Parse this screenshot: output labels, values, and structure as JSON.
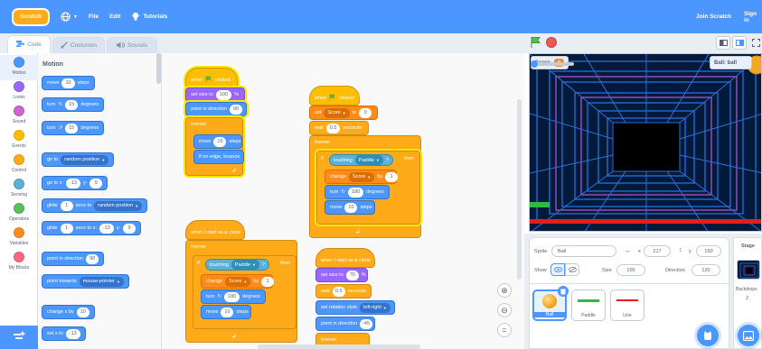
{
  "menu": {
    "logo": "Scratch",
    "file": "File",
    "edit": "Edit",
    "tutorials": "Tutorials",
    "join": "Join Scratch",
    "signin": "Sign in"
  },
  "tabs": {
    "code": "Code",
    "costumes": "Costumes",
    "sounds": "Sounds"
  },
  "categories": [
    {
      "label": "Motion",
      "color": "#4c97ff"
    },
    {
      "label": "Looks",
      "color": "#9966ff"
    },
    {
      "label": "Sound",
      "color": "#cf63cf"
    },
    {
      "label": "Events",
      "color": "#ffbf00"
    },
    {
      "label": "Control",
      "color": "#ffab19"
    },
    {
      "label": "Sensing",
      "color": "#5cb1d6"
    },
    {
      "label": "Operators",
      "color": "#59c059"
    },
    {
      "label": "Variables",
      "color": "#ff8c1a"
    },
    {
      "label": "My Blocks",
      "color": "#ff6680"
    }
  ],
  "palette": {
    "title": "Motion",
    "move": {
      "pre": "move",
      "val": "10",
      "post": "steps"
    },
    "turn_right": {
      "pre": "turn",
      "val": "15",
      "post": "degrees"
    },
    "turn_left": {
      "pre": "turn",
      "val": "15",
      "post": "degrees"
    },
    "goto": {
      "pre": "go to",
      "opt": "random position"
    },
    "goto_xy": {
      "pre": "go to x:",
      "x": "-13",
      "ylab": "y:",
      "y": "9"
    },
    "glide_to": {
      "pre": "glide",
      "val": "1",
      "mid": "secs to",
      "opt": "random position"
    },
    "glide_xy": {
      "pre": "glide",
      "val": "1",
      "mid": "secs to x:",
      "x": "-13",
      "ylab": "y:",
      "y": "9"
    },
    "point_dir": {
      "pre": "point in direction",
      "val": "90"
    },
    "point_towards": {
      "pre": "point towards",
      "opt": "mouse-pointer"
    },
    "change_x": {
      "pre": "change x by",
      "val": "10"
    },
    "set_x": {
      "pre": "set x to",
      "val": "-13"
    }
  },
  "script1": {
    "hat": "when",
    "hat_post": "clicked",
    "setsize": {
      "pre": "set size to",
      "val": "100",
      "post": "%"
    },
    "point": {
      "pre": "point in direction",
      "val": "90"
    },
    "forever": "forever",
    "move": {
      "pre": "move",
      "val": "15",
      "post": "steps"
    },
    "bounce": "if on edge, bounce"
  },
  "script2": {
    "hat": "when",
    "hat_post": "clicked",
    "set": {
      "pre": "set",
      "var": "Score",
      "mid": "to",
      "val": "0"
    },
    "wait": {
      "pre": "wait",
      "val": "0.5",
      "post": "seconds"
    },
    "forever": "forever",
    "if_pre": "if",
    "touching": "touching",
    "touch_opt": "Paddle",
    "q": "?",
    "then": "then",
    "change": {
      "pre": "change",
      "var": "Score",
      "mid": "by",
      "val": "1"
    },
    "turn": {
      "pre": "turn",
      "val": "180",
      "post": "degrees"
    },
    "move": {
      "pre": "move",
      "val": "10",
      "post": "steps"
    }
  },
  "script3": {
    "hat": "when I start as a clone",
    "forever": "forever",
    "if_pre": "if",
    "touching": "touching",
    "touch_opt": "Paddle",
    "q": "?",
    "then": "then",
    "change": {
      "pre": "change",
      "var": "Score",
      "mid": "by",
      "val": "1"
    },
    "turn": {
      "pre": "turn",
      "val": "180",
      "post": "degrees"
    },
    "move": {
      "pre": "move",
      "val": "10",
      "post": "steps"
    }
  },
  "script4": {
    "hat": "when I start as a clone",
    "setsize": {
      "pre": "set size to",
      "val": "70",
      "post": "%"
    },
    "wait": {
      "pre": "wait",
      "val": "0.5",
      "post": "seconds"
    },
    "rotation": {
      "pre": "set rotation style",
      "opt": "left-right"
    },
    "point": {
      "pre": "point in direction",
      "val": "-45"
    },
    "forever": "forever"
  },
  "stage": {
    "score_label": "Score",
    "score_value": "0",
    "ball_label": "Ball: ball",
    "ball_value": "0"
  },
  "sprite_info": {
    "sprite_label": "Sprite",
    "sprite_name": "Ball",
    "x_label": "x",
    "x": "217",
    "y_label": "y",
    "y": "150",
    "show_label": "Show",
    "size_label": "Size",
    "size": "100",
    "direction_label": "Direction",
    "direction": "120"
  },
  "sprites": [
    {
      "name": "Ball",
      "selected": true
    },
    {
      "name": "Paddle",
      "selected": false
    },
    {
      "name": "Line",
      "selected": false
    }
  ],
  "stage_panel": {
    "title": "Stage",
    "backdrops_label": "Backdrops",
    "backdrops_count": "2"
  }
}
